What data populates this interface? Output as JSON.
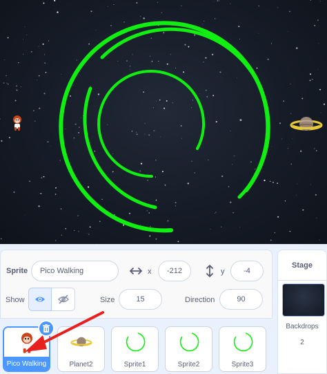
{
  "stage": {
    "background": "starfield",
    "ring_color": "#11ee11"
  },
  "sprite_info": {
    "sprite_label": "Sprite",
    "sprite_name": "Pico Walking",
    "x_label": "x",
    "x_value": "-212",
    "y_label": "y",
    "y_value": "-4",
    "show_label": "Show",
    "size_label": "Size",
    "size_value": "15",
    "direction_label": "Direction",
    "direction_value": "90"
  },
  "sprites": [
    {
      "name": "Pico Walking",
      "selected": true,
      "icon": "monkey-icon"
    },
    {
      "name": "Planet2",
      "selected": false,
      "icon": "planet-icon"
    },
    {
      "name": "Sprite1",
      "selected": false,
      "icon": "ring-icon"
    },
    {
      "name": "Sprite2",
      "selected": false,
      "icon": "ring-icon"
    },
    {
      "name": "Sprite3",
      "selected": false,
      "icon": "ring-icon"
    }
  ],
  "stage_target": {
    "title": "Stage",
    "backdrops_label": "Backdrops",
    "backdrops_count": "2"
  },
  "colors": {
    "accent": "#4c97ff",
    "ring_green": "#11ee11",
    "annotation_arrow": "#e8201d"
  }
}
